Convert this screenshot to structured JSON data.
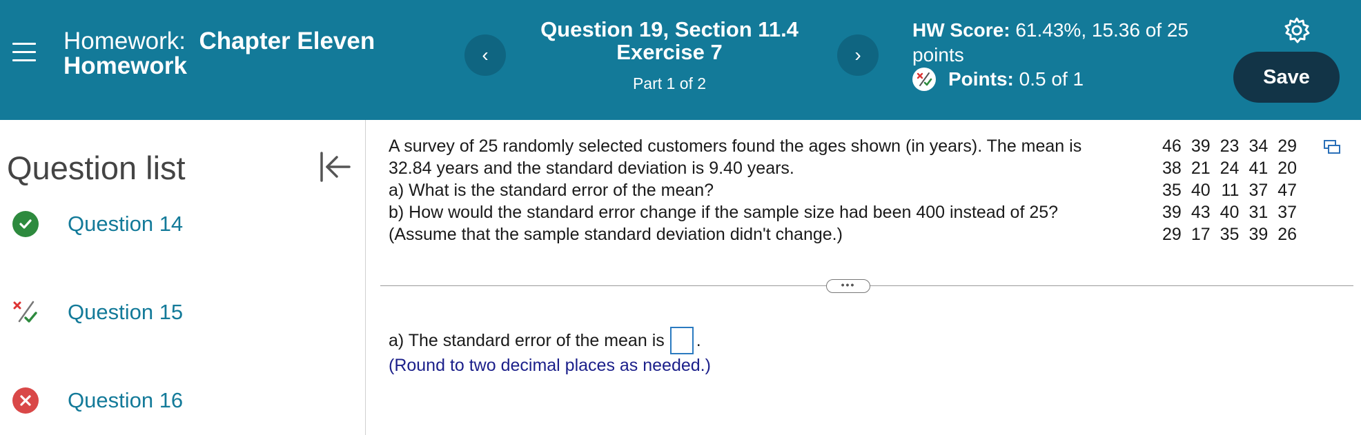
{
  "header": {
    "homework_prefix": "Homework:",
    "homework_name_1": "Chapter Eleven",
    "homework_name_2": "Homework",
    "question_title_1": "Question 19, Section 11.4",
    "question_title_2": "Exercise 7",
    "part": "Part 1 of 2",
    "hw_score_label": "HW Score:",
    "hw_score_value": "61.43%, 15.36 of 25 points",
    "points_label": "Points:",
    "points_value": "0.5 of 1",
    "save_label": "Save",
    "prev_glyph": "‹",
    "next_glyph": "›",
    "accent_color": "#137a99"
  },
  "sidebar": {
    "title": "Question list",
    "items": [
      {
        "label": "Question 14",
        "status": "correct",
        "status_icon": "check-circle-icon"
      },
      {
        "label": "Question 15",
        "status": "partial",
        "status_icon": "partial-credit-icon"
      },
      {
        "label": "Question 16",
        "status": "incorrect",
        "status_icon": "x-circle-icon"
      }
    ]
  },
  "problem": {
    "line1": "A survey of 25 randomly selected customers found the ages shown (in years). The mean is",
    "line2": "32.84 years and the standard deviation is 9.40 years.",
    "line3": "a) What is the standard error of the mean?",
    "line4": "b) How would the standard error change if the sample size had been 400 instead of 25?",
    "line5": "(Assume that the sample standard deviation didn't change.)",
    "data_rows": [
      [
        "46",
        "39",
        "23",
        "34",
        "29"
      ],
      [
        "38",
        "21",
        "24",
        "41",
        "20"
      ],
      [
        "35",
        "40",
        "11",
        "37",
        "47"
      ],
      [
        "39",
        "43",
        "40",
        "31",
        "37"
      ],
      [
        "29",
        "17",
        "35",
        "39",
        "26"
      ]
    ]
  },
  "answer": {
    "prompt": "a) The standard error of the mean is",
    "suffix": ".",
    "value": "",
    "note": "(Round to two decimal places as needed.)"
  },
  "expand_label": "•••"
}
